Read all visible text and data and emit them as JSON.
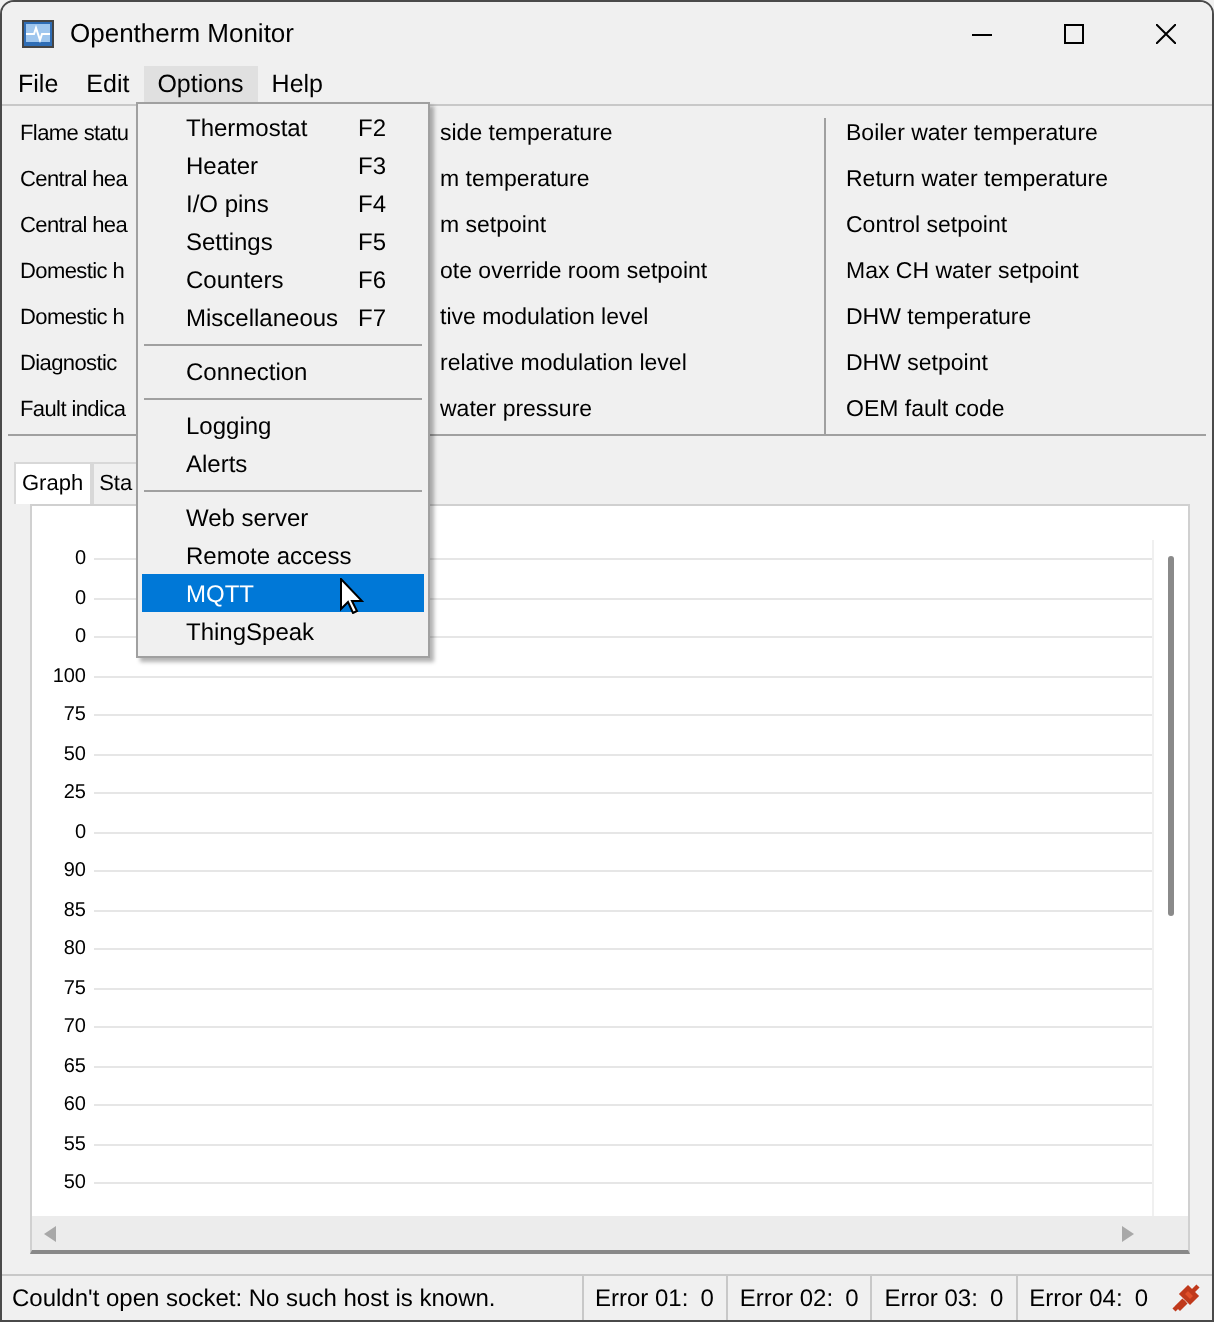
{
  "window": {
    "title": "Opentherm Monitor"
  },
  "menu_bar": [
    {
      "label": "File",
      "open": false
    },
    {
      "label": "Edit",
      "open": false
    },
    {
      "label": "Options",
      "open": true
    },
    {
      "label": "Help",
      "open": false
    }
  ],
  "options_menu": [
    {
      "kind": "item",
      "label": "Thermostat",
      "shortcut": "F2",
      "selected": false
    },
    {
      "kind": "item",
      "label": "Heater",
      "shortcut": "F3",
      "selected": false
    },
    {
      "kind": "item",
      "label": "I/O pins",
      "shortcut": "F4",
      "selected": false
    },
    {
      "kind": "item",
      "label": "Settings",
      "shortcut": "F5",
      "selected": false
    },
    {
      "kind": "item",
      "label": "Counters",
      "shortcut": "F6",
      "selected": false
    },
    {
      "kind": "item",
      "label": "Miscellaneous",
      "shortcut": "F7",
      "selected": false
    },
    {
      "kind": "separator"
    },
    {
      "kind": "item",
      "label": "Connection",
      "selected": false
    },
    {
      "kind": "separator"
    },
    {
      "kind": "item",
      "label": "Logging",
      "selected": false
    },
    {
      "kind": "item",
      "label": "Alerts",
      "selected": false
    },
    {
      "kind": "separator"
    },
    {
      "kind": "item",
      "label": "Web server",
      "selected": false
    },
    {
      "kind": "item",
      "label": "Remote access",
      "selected": false
    },
    {
      "kind": "item",
      "label": "MQTT",
      "selected": true
    },
    {
      "kind": "item",
      "label": "ThingSpeak",
      "selected": false
    }
  ],
  "fields": {
    "column_1": [
      "Flame statu",
      "Central hea",
      "Central hea",
      "Domestic h",
      "Domestic h",
      "Diagnostic",
      "Fault indica"
    ],
    "column_2": [
      "side temperature",
      "m temperature",
      "m setpoint",
      "ote override room setpoint",
      "tive modulation level",
      "relative modulation level",
      "water pressure"
    ],
    "column_3": [
      "Boiler water temperature",
      "Return water temperature",
      "Control setpoint",
      "Max CH water setpoint",
      "DHW temperature",
      "DHW setpoint",
      "OEM fault code"
    ]
  },
  "tabs": [
    {
      "label": "Graph",
      "selected": true
    },
    {
      "label": "Sta",
      "selected": false
    }
  ],
  "graph": {
    "axis_labels": [
      "0",
      "0",
      "0",
      "100",
      "75",
      "50",
      "25",
      "0",
      "90",
      "85",
      "80",
      "75",
      "70",
      "65",
      "60",
      "55",
      "50"
    ]
  },
  "status_bar": {
    "message": "Couldn't open socket: No such host is known.",
    "errors": [
      {
        "label": "Error 01:",
        "value": "0"
      },
      {
        "label": "Error 02:",
        "value": "0"
      },
      {
        "label": "Error 03:",
        "value": "0"
      },
      {
        "label": "Error 04:",
        "value": "0"
      }
    ]
  }
}
